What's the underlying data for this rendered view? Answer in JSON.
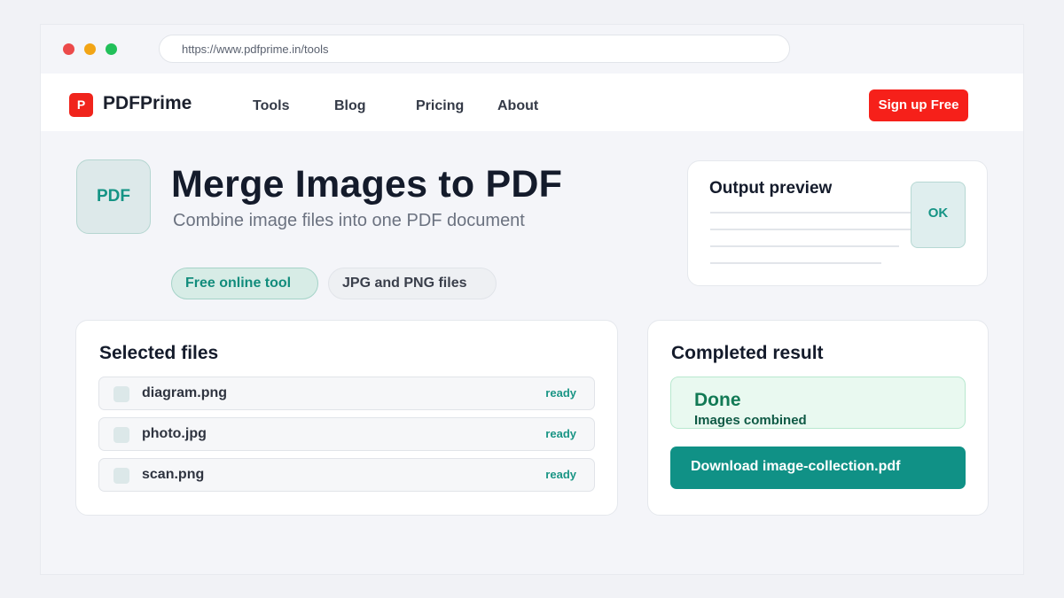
{
  "browser": {
    "url": "https://www.pdfprime.in/tools"
  },
  "nav": {
    "logo_letter": "P",
    "brand": "PDFPrime",
    "links": [
      "Tools",
      "Blog",
      "Pricing",
      "About"
    ],
    "signup_label": "Sign up Free"
  },
  "hero": {
    "badge": "PDF",
    "title": "Merge Images to PDF",
    "subtitle": "Combine image files into one PDF document",
    "chips": [
      "Free online tool",
      "JPG and PNG files"
    ]
  },
  "preview": {
    "title": "Output preview",
    "ok_label": "OK"
  },
  "files": {
    "title": "Selected files",
    "items": [
      {
        "name": "diagram.png",
        "status": "ready"
      },
      {
        "name": "photo.jpg",
        "status": "ready"
      },
      {
        "name": "scan.png",
        "status": "ready"
      }
    ]
  },
  "result": {
    "title": "Completed result",
    "status_title": "Done",
    "status_sub": "Images combined",
    "download_label": "Download image-collection.pdf"
  },
  "colors": {
    "brand_red": "#f6201a",
    "accent_teal": "#109186",
    "success_bg": "#e9f9f0"
  }
}
